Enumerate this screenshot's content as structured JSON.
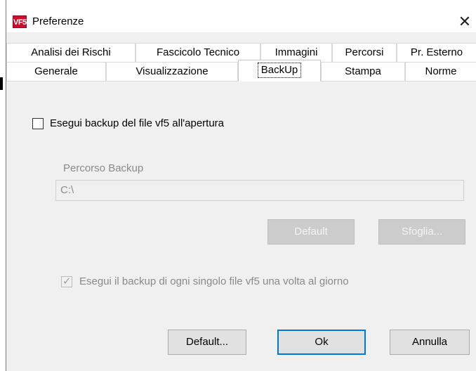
{
  "window": {
    "title": "Preferenze",
    "icon_text": "VF5",
    "close_glyph": "✕"
  },
  "tabs": {
    "back_row": [
      "Analisi dei Rischi",
      "Fascicolo Tecnico",
      "Immagini",
      "Percorsi",
      "Pr. Esterno"
    ],
    "front_row": [
      "Generale",
      "Visualizzazione",
      "BackUp",
      "Stampa",
      "Norme"
    ],
    "selected": "BackUp"
  },
  "backup": {
    "run_on_open_label": "Esegui backup del file vf5 all'apertura",
    "run_on_open_checked": false,
    "path_label": "Percorso Backup",
    "path_value": "C:\\",
    "default_button": "Default",
    "browse_button": "Sfoglia...",
    "daily_label": "Esegui il backup di ogni singolo file vf5 una volta al giorno",
    "daily_checked": true
  },
  "footer": {
    "default_button": "Default...",
    "ok_button": "Ok",
    "cancel_button": "Annulla"
  }
}
